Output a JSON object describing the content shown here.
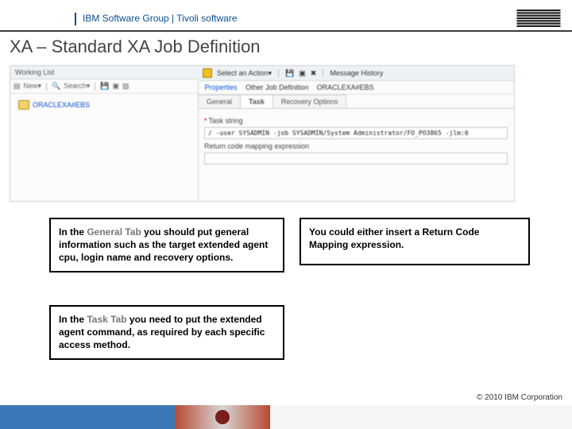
{
  "header": {
    "group": "IBM Software Group | Tivoli software",
    "logo_alt": "IBM"
  },
  "title": "XA – Standard XA Job Definition",
  "app": {
    "working_list": "Working List",
    "left_toolbar": {
      "new": "New▾",
      "search": "Search▾"
    },
    "tree_item": "ORACLEXA#EBS",
    "right_toolbar": {
      "select_action": "Select an Action▾",
      "message_history": "Message History"
    },
    "crumb": {
      "properties": "Properties",
      "other_def": "Other Job Definition",
      "current": "ORACLEXA#EBS"
    },
    "tabs": {
      "general": "General",
      "task": "Task",
      "recovery": "Recovery Options"
    },
    "task_label": "Task string",
    "task_value": "/ -user SYSADMIN -job SYSADMIN/System Administrator/FO_PO3865 -jlm:0",
    "return_code_label": "Return code mapping expression"
  },
  "callouts": {
    "c1_prefix": "In the ",
    "c1_soft": "General Tab",
    "c1_rest": " you should put general information such as the target extended agent cpu, login name and recovery options.",
    "c2": "You could either insert a Return Code Mapping expression.",
    "c3_prefix": "In the ",
    "c3_soft": "Task Tab",
    "c3_rest": " you need to put the extended agent command, as required by each specific access method."
  },
  "footer": {
    "copyright": "© 2010 IBM Corporation"
  }
}
